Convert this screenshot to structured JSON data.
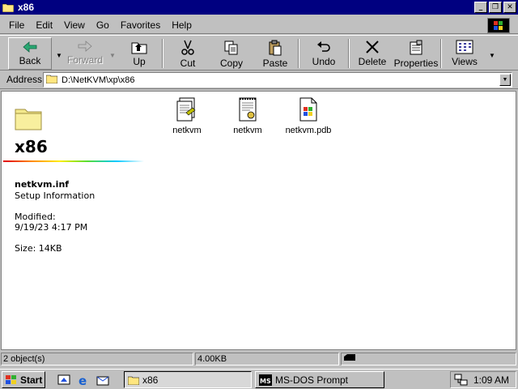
{
  "window": {
    "title": "x86"
  },
  "menu": [
    "File",
    "Edit",
    "View",
    "Go",
    "Favorites",
    "Help"
  ],
  "toolbar": {
    "back": "Back",
    "forward": "Forward",
    "up": "Up",
    "cut": "Cut",
    "copy": "Copy",
    "paste": "Paste",
    "undo": "Undo",
    "delete": "Delete",
    "properties": "Properties",
    "views": "Views"
  },
  "address": {
    "label": "Address",
    "value": "D:\\NetKVM\\xp\\x86"
  },
  "folder": {
    "title": "x86",
    "selected_name": "netkvm.inf",
    "selected_type": "Setup Information",
    "modified_label": "Modified:",
    "modified_value": "9/19/23 4:17 PM",
    "size": "Size: 14KB"
  },
  "files": [
    {
      "name": "netkvm",
      "icon": "setup-info-file-icon"
    },
    {
      "name": "netkvm",
      "icon": "security-catalog-file-icon"
    },
    {
      "name": "netkvm.pdb",
      "icon": "windows-file-icon"
    }
  ],
  "status": {
    "objects": "2 object(s)",
    "size": "4.00KB"
  },
  "taskbar": {
    "start": "Start",
    "tasks": [
      {
        "label": "x86",
        "active": true
      },
      {
        "label": "MS-DOS Prompt",
        "active": false
      }
    ],
    "clock": "1:09 AM"
  },
  "colors": {
    "titlebar": "#000080",
    "face": "#c0c0c0"
  }
}
